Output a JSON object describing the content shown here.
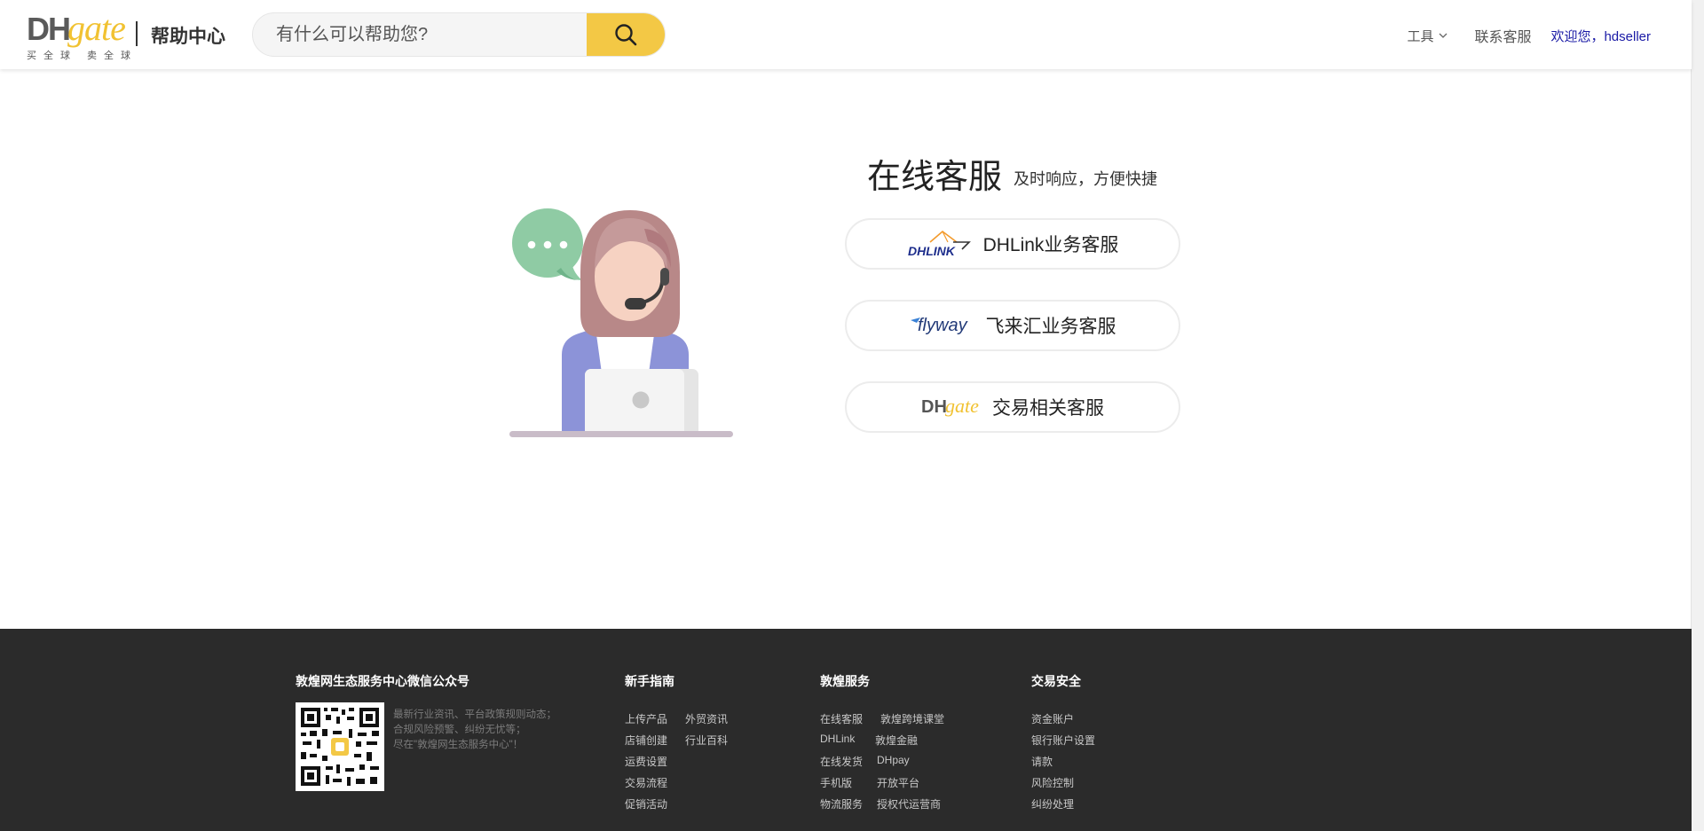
{
  "header": {
    "logo_dh": "DH",
    "logo_gate": "gate",
    "logo_slogan": "买全球 卖全球",
    "help_center": "帮助中心",
    "search": {
      "placeholder": "有什么可以帮助您?"
    },
    "nav": {
      "tools": "工具",
      "contact": "联系客服",
      "welcome": "欢迎您，hdseller"
    }
  },
  "main": {
    "title": "在线客服",
    "subtitle": "及时响应，方便快捷",
    "services": [
      {
        "logo": "DHLINK",
        "label": "DHLink业务客服"
      },
      {
        "logo": "flyway",
        "label": "飞来汇业务客服"
      },
      {
        "logo_dh": "DH",
        "logo_gate": "gate",
        "label": "交易相关客服"
      }
    ]
  },
  "footer": {
    "wechat": {
      "title": "敦煌网生态服务中心微信公众号",
      "desc_lines": [
        "最新行业资讯、平台政策规则动态；",
        "合规风险预警、纠纷无忧等；",
        "尽在\"敦煌网生态服务中心\"！"
      ]
    },
    "columns": [
      {
        "title": "新手指南",
        "col1": [
          "上传产品",
          "店铺创建",
          "运费设置",
          "交易流程",
          "促销活动"
        ],
        "col2": [
          "外贸资讯",
          "行业百科"
        ]
      },
      {
        "title": "敦煌服务",
        "col1": [
          "在线客服",
          "DHLink",
          "在线发货",
          "手机版",
          "物流服务"
        ],
        "col2": [
          "敦煌跨境课堂",
          "敦煌金融",
          "DHpay",
          "开放平台",
          "授权代运营商"
        ]
      },
      {
        "title": "交易安全",
        "col1": [
          "资金账户",
          "银行账户设置",
          "请款",
          "风险控制",
          "纠纷处理"
        ]
      }
    ]
  },
  "colors": {
    "accent_yellow": "#f3c845",
    "footer_bg": "#2b2b2b",
    "welcome_link": "#1a1aa6"
  },
  "icons": [
    "search-icon",
    "chevron-down-icon",
    "chat-bubble-icon",
    "customer-service-illustration",
    "qr-code"
  ]
}
